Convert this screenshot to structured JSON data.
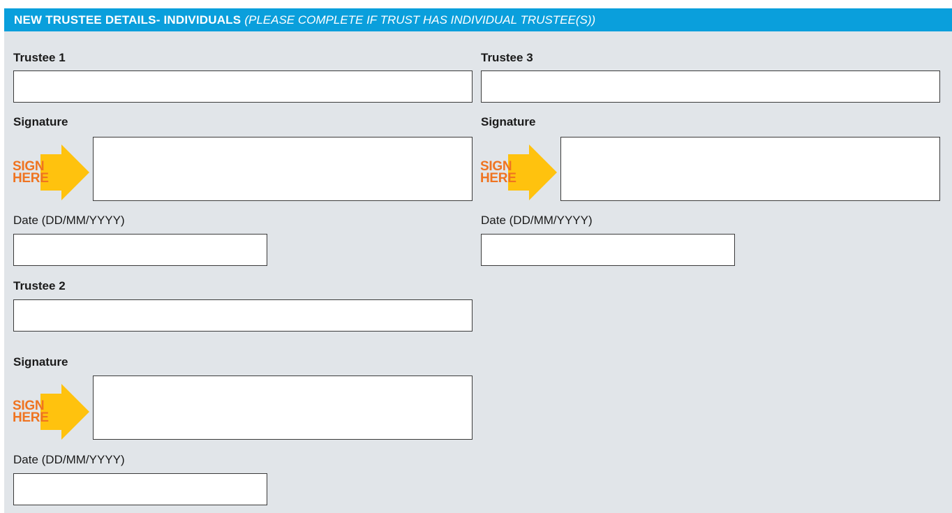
{
  "header": {
    "title": "NEW TRUSTEE DETAILS- INDIVIDUALS",
    "subtitle": "(PLEASE COMPLETE IF TRUST HAS INDIVIDUAL TRUSTEE(S))"
  },
  "sign_here": {
    "line1": "SIGN",
    "line2": "HERE"
  },
  "colors": {
    "header_bg": "#0a9fdc",
    "section_bg": "#e1e5e9",
    "sign_text": "#ef7421",
    "arrow": "#ffc20e"
  },
  "trustees": [
    {
      "label": "Trustee 1",
      "signature_label": "Signature",
      "date_label": "Date (DD/MM/YYYY)"
    },
    {
      "label": "Trustee 2",
      "signature_label": "Signature",
      "date_label": "Date (DD/MM/YYYY)"
    },
    {
      "label": "Trustee 3",
      "signature_label": "Signature",
      "date_label": "Date (DD/MM/YYYY)"
    }
  ]
}
